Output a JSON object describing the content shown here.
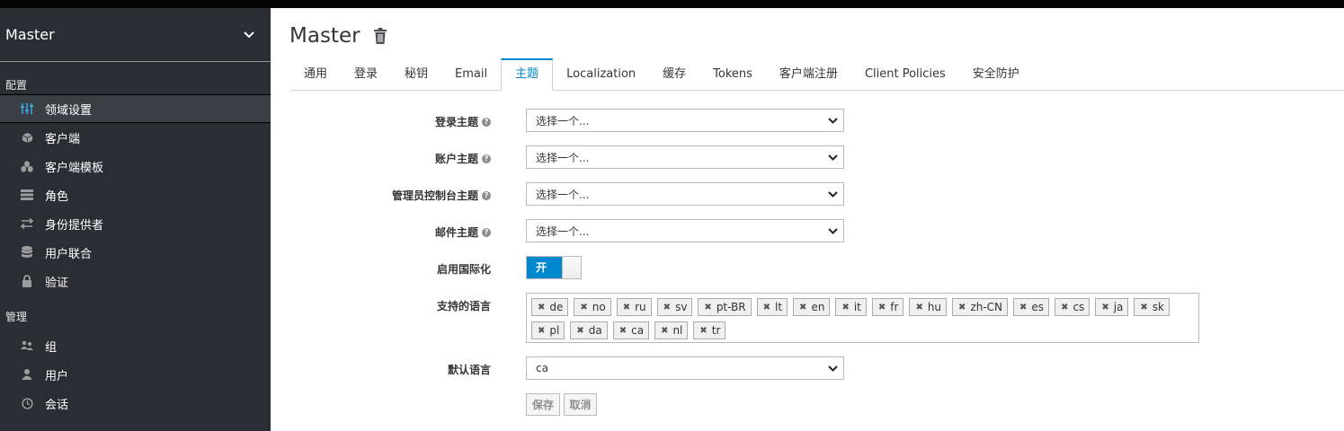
{
  "sidebar": {
    "realm": "Master",
    "config_title": "配置",
    "config_items": [
      {
        "label": "领域设置",
        "icon": "sliders-icon",
        "active": true
      },
      {
        "label": "客户端",
        "icon": "cube-icon"
      },
      {
        "label": "客户端模板",
        "icon": "cubes-icon"
      },
      {
        "label": "角色",
        "icon": "list-icon"
      },
      {
        "label": "身份提供者",
        "icon": "exchange-icon"
      },
      {
        "label": "用户联合",
        "icon": "database-icon"
      },
      {
        "label": "验证",
        "icon": "lock-icon"
      }
    ],
    "manage_title": "管理",
    "manage_items": [
      {
        "label": "组",
        "icon": "users-icon"
      },
      {
        "label": "用户",
        "icon": "user-icon"
      },
      {
        "label": "会话",
        "icon": "clock-icon"
      }
    ]
  },
  "page": {
    "title": "Master",
    "tabs": [
      "通用",
      "登录",
      "秘钥",
      "Email",
      "主题",
      "Localization",
      "缓存",
      "Tokens",
      "客户端注册",
      "Client Policies",
      "安全防护"
    ],
    "active_tab": "主题"
  },
  "form": {
    "login_theme_label": "登录主题",
    "login_theme_value": "选择一个...",
    "account_theme_label": "账户主题",
    "account_theme_value": "选择一个...",
    "admin_theme_label": "管理员控制台主题",
    "admin_theme_value": "选择一个...",
    "email_theme_label": "邮件主题",
    "email_theme_value": "选择一个...",
    "i18n_label": "启用国际化",
    "i18n_toggle_text": "开",
    "i18n_enabled": true,
    "locales_label": "支持的语言",
    "locales": [
      "de",
      "no",
      "ru",
      "sv",
      "pt-BR",
      "lt",
      "en",
      "it",
      "fr",
      "hu",
      "zh-CN",
      "es",
      "cs",
      "ja",
      "sk",
      "pl",
      "da",
      "ca",
      "nl",
      "tr"
    ],
    "default_locale_label": "默认语言",
    "default_locale_value": "ca",
    "save_label": "保存",
    "cancel_label": "取消"
  },
  "colors": {
    "accent": "#0088ce",
    "sidebar_bg": "#292e34",
    "active_nav_icon": "#39a5dc"
  }
}
